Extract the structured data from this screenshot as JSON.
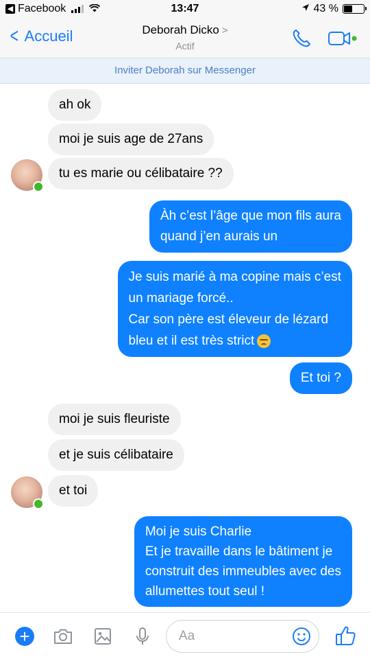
{
  "status_bar": {
    "app_back": "Facebook",
    "time": "13:47",
    "battery": "43 %",
    "battery_level": 0.43
  },
  "header": {
    "back_label": "Accueil",
    "contact_name": "Deborah Dicko",
    "contact_status": "Actif"
  },
  "invite_banner": "Inviter Deborah sur Messenger",
  "messages": [
    {
      "from": "them",
      "lines": [
        "ah ok"
      ]
    },
    {
      "from": "them",
      "lines": [
        "moi je  suis age  de  27ans"
      ]
    },
    {
      "from": "them",
      "lines": [
        "tu  es  marie  ou célibataire ??"
      ]
    },
    {
      "from": "me",
      "lines": [
        "Àh c’est l’âge que mon fils aura",
        "quand j’en aurais un"
      ]
    },
    {
      "from": "me",
      "lines": [
        "Je suis marié à ma copine mais c’est",
        "un mariage forcé..",
        "Car son père est éleveur de lézard",
        "bleu et il est très strict"
      ],
      "emoji": "disappointed-face-emoji"
    },
    {
      "from": "me",
      "lines": [
        "Et toi ?"
      ]
    },
    {
      "from": "them",
      "lines": [
        "moi je suis  fleuriste"
      ]
    },
    {
      "from": "them",
      "lines": [
        "et je suis célibataire"
      ]
    },
    {
      "from": "them",
      "lines": [
        "et  toi"
      ]
    },
    {
      "from": "me",
      "lines": [
        "Moi je suis Charlie",
        "Et je travaille dans le bâtiment je",
        "construit des immeubles avec des",
        "allumettes tout seul !"
      ]
    }
  ],
  "composer": {
    "placeholder": "Aa"
  },
  "icons": {
    "call": "phone-icon",
    "video": "video-camera-icon",
    "plus": "plus-icon",
    "camera": "camera-icon",
    "gallery": "image-icon",
    "mic": "microphone-icon",
    "emoji": "smile-icon",
    "like": "thumbs-up-icon"
  },
  "colors": {
    "accent": "#1a7cf7",
    "outgoing_bubble": "#0f81ff",
    "incoming_bubble": "#f0f0f0",
    "online": "#42b72a",
    "banner_bg": "#e9f1fb",
    "banner_text": "#4b80c4"
  }
}
